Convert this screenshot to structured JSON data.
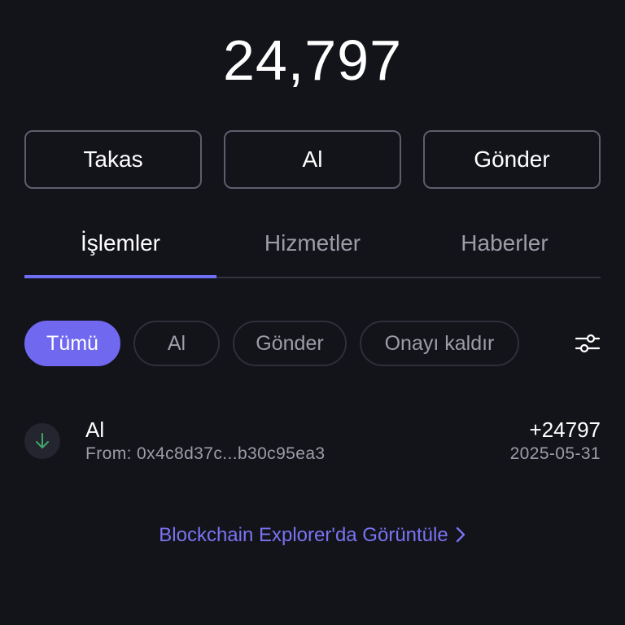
{
  "balance": "24,797",
  "actions": {
    "swap_label": "Takas",
    "receive_label": "Al",
    "send_label": "Gönder"
  },
  "tabs": [
    {
      "label": "İşlemler",
      "active": true
    },
    {
      "label": "Hizmetler",
      "active": false
    },
    {
      "label": "Haberler",
      "active": false
    }
  ],
  "filters": [
    {
      "label": "Tümü",
      "active": true
    },
    {
      "label": "Al",
      "active": false
    },
    {
      "label": "Gönder",
      "active": false
    },
    {
      "label": "Onayı kaldır",
      "active": false
    }
  ],
  "filter_icon": "sliders-icon",
  "transactions": [
    {
      "icon": "arrow-down-icon",
      "title": "Al",
      "from": "From: 0x4c8d37c...b30c95ea3",
      "amount": "+24797",
      "date": "2025-05-31"
    }
  ],
  "explorer_link": "Blockchain Explorer'da Görüntüle",
  "colors": {
    "background": "#13131a",
    "accent": "#7168f0",
    "link": "#7a74f2",
    "receive_arrow": "#3fa76a",
    "muted_text": "#9c9da8"
  }
}
